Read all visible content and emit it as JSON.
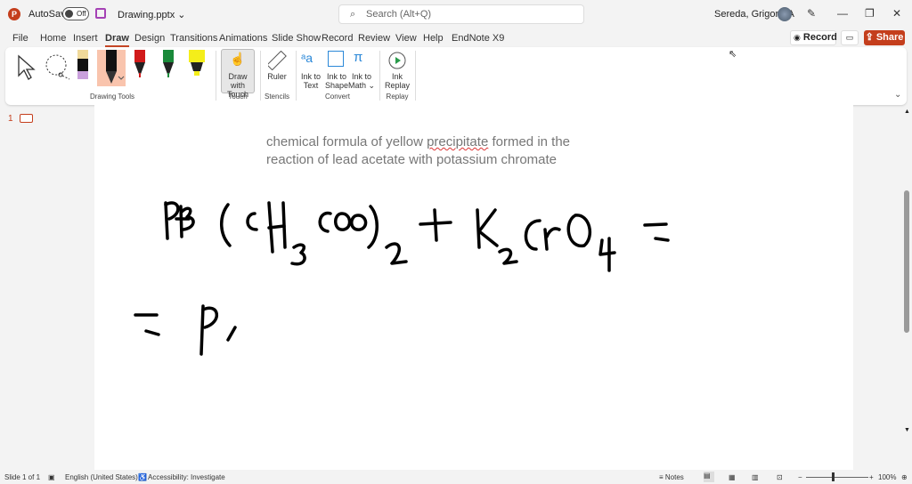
{
  "titlebar": {
    "app_icon": "P",
    "autosave": "AutoSave",
    "autosave_state": "Off",
    "filename": "Drawing.pptx",
    "search_placeholder": "Search (Alt+Q)",
    "user": "Sereda, Grigoriy A"
  },
  "tabs": [
    "File",
    "Home",
    "Insert",
    "Draw",
    "Design",
    "Transitions",
    "Animations",
    "Slide Show",
    "Record",
    "Review",
    "View",
    "Help",
    "EndNote X9"
  ],
  "active_tab": "Draw",
  "actions": {
    "record": "Record",
    "share": "Share"
  },
  "ribbon": {
    "groups": {
      "drawing_tools": "Drawing Tools",
      "touch": "Touch",
      "stencils": "Stencils",
      "convert": "Convert",
      "replay": "Replay"
    },
    "buttons": {
      "draw_with_touch_1": "Draw with",
      "draw_with_touch_2": "Touch",
      "ruler": "Ruler",
      "ink_to_text_1": "Ink to",
      "ink_to_text_2": "Text",
      "ink_to_shape_1": "Ink to",
      "ink_to_shape_2": "Shape",
      "ink_to_math_1": "Ink to",
      "ink_to_math_2": "Math",
      "ink_replay_1": "Ink",
      "ink_replay_2": "Replay"
    },
    "pen_colors": [
      "#000000",
      "#d11a1a",
      "#1a8a3a",
      "#f4ee1a"
    ]
  },
  "thumbnails": {
    "slide_number": "1"
  },
  "slide": {
    "prompt_line1": "chemical formula of yellow",
    "prompt_spell": "precipitate",
    "prompt_line1_end": "formed in the",
    "prompt_line2": "reaction of lead acetate with potassium chromate"
  },
  "status": {
    "slide": "Slide 1 of 1",
    "language": "English (United States)",
    "accessibility": "Accessibility: Investigate",
    "notes": "Notes",
    "zoom": "100%"
  }
}
